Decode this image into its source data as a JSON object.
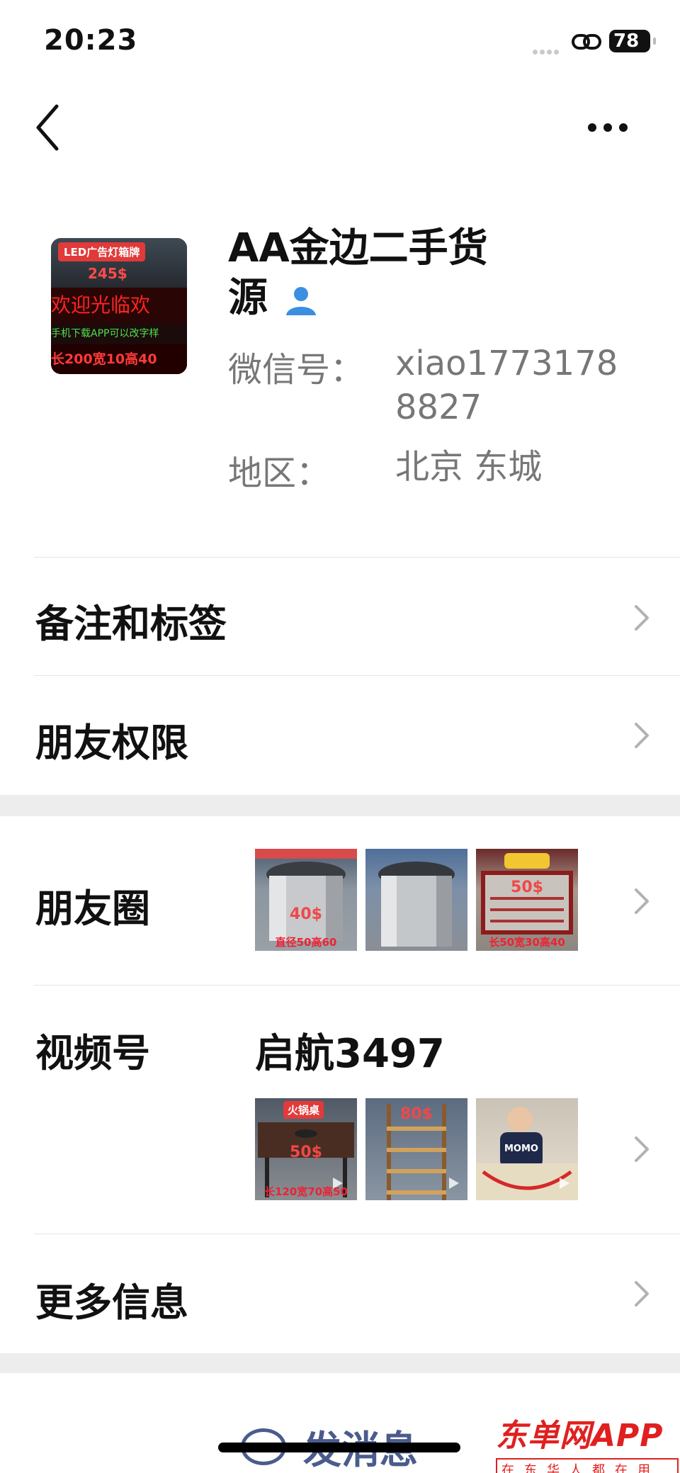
{
  "status_bar": {
    "time": "20:23",
    "battery": "78"
  },
  "nav": {
    "back_icon": "chevron-left-icon",
    "more_icon": "ellipsis-icon"
  },
  "profile": {
    "avatar": {
      "tag": "LED广告灯箱牌",
      "price": "245$",
      "led_text": "欢迎光临欢",
      "hint": "手机下载APP可以改字样",
      "size": "长200宽10高40"
    },
    "name": "AA金边二手货源",
    "name_icon": "person-icon",
    "wechat_label": "微信号：",
    "wechat_id": "xiao17731788827",
    "region_label": "地区：",
    "region": "北京 东城"
  },
  "rows": {
    "remarks": "备注和标签",
    "permissions": "朋友权限",
    "moments": "朋友圈",
    "channels": "视频号",
    "channel_name": "启航3497",
    "more_info": "更多信息"
  },
  "moments_thumbs": [
    {
      "price": "40$",
      "caption": "直径50高60"
    },
    {
      "price": "",
      "caption": ""
    },
    {
      "price": "50$",
      "caption": "长50宽30高40"
    }
  ],
  "channel_thumbs": [
    {
      "tag": "火锅桌",
      "price": "50$",
      "caption": "长120宽70高50"
    },
    {
      "tag": "",
      "price": "80$",
      "caption": ""
    },
    {
      "tag": "",
      "price": "",
      "caption": "MOMO"
    }
  ],
  "bottom": {
    "send_message": "发消息"
  },
  "watermark": {
    "brand": "东单网APP",
    "slogan": "在东华人都在用"
  }
}
